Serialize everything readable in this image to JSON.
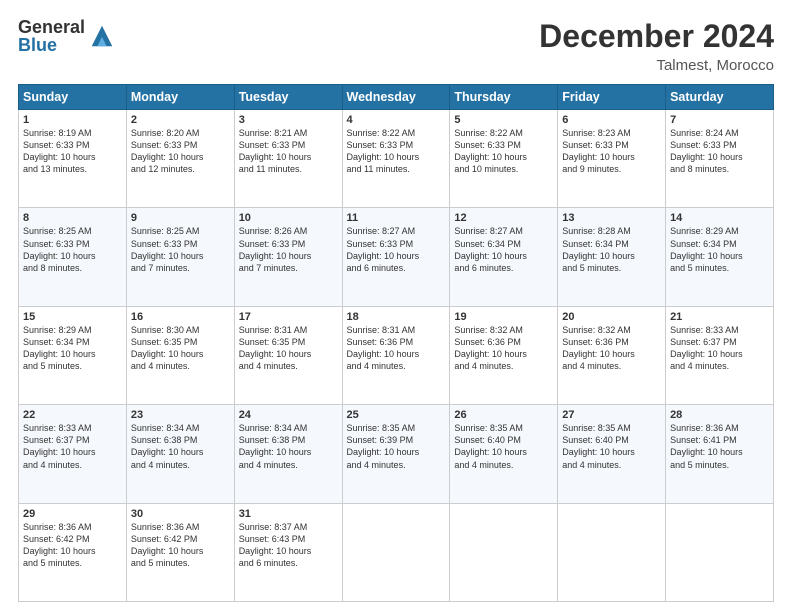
{
  "header": {
    "logo_general": "General",
    "logo_blue": "Blue",
    "title": "December 2024",
    "location": "Talmest, Morocco"
  },
  "days_of_week": [
    "Sunday",
    "Monday",
    "Tuesday",
    "Wednesday",
    "Thursday",
    "Friday",
    "Saturday"
  ],
  "weeks": [
    [
      {
        "day": "1",
        "info": "Sunrise: 8:19 AM\nSunset: 6:33 PM\nDaylight: 10 hours\nand 13 minutes."
      },
      {
        "day": "2",
        "info": "Sunrise: 8:20 AM\nSunset: 6:33 PM\nDaylight: 10 hours\nand 12 minutes."
      },
      {
        "day": "3",
        "info": "Sunrise: 8:21 AM\nSunset: 6:33 PM\nDaylight: 10 hours\nand 11 minutes."
      },
      {
        "day": "4",
        "info": "Sunrise: 8:22 AM\nSunset: 6:33 PM\nDaylight: 10 hours\nand 11 minutes."
      },
      {
        "day": "5",
        "info": "Sunrise: 8:22 AM\nSunset: 6:33 PM\nDaylight: 10 hours\nand 10 minutes."
      },
      {
        "day": "6",
        "info": "Sunrise: 8:23 AM\nSunset: 6:33 PM\nDaylight: 10 hours\nand 9 minutes."
      },
      {
        "day": "7",
        "info": "Sunrise: 8:24 AM\nSunset: 6:33 PM\nDaylight: 10 hours\nand 8 minutes."
      }
    ],
    [
      {
        "day": "8",
        "info": "Sunrise: 8:25 AM\nSunset: 6:33 PM\nDaylight: 10 hours\nand 8 minutes."
      },
      {
        "day": "9",
        "info": "Sunrise: 8:25 AM\nSunset: 6:33 PM\nDaylight: 10 hours\nand 7 minutes."
      },
      {
        "day": "10",
        "info": "Sunrise: 8:26 AM\nSunset: 6:33 PM\nDaylight: 10 hours\nand 7 minutes."
      },
      {
        "day": "11",
        "info": "Sunrise: 8:27 AM\nSunset: 6:33 PM\nDaylight: 10 hours\nand 6 minutes."
      },
      {
        "day": "12",
        "info": "Sunrise: 8:27 AM\nSunset: 6:34 PM\nDaylight: 10 hours\nand 6 minutes."
      },
      {
        "day": "13",
        "info": "Sunrise: 8:28 AM\nSunset: 6:34 PM\nDaylight: 10 hours\nand 5 minutes."
      },
      {
        "day": "14",
        "info": "Sunrise: 8:29 AM\nSunset: 6:34 PM\nDaylight: 10 hours\nand 5 minutes."
      }
    ],
    [
      {
        "day": "15",
        "info": "Sunrise: 8:29 AM\nSunset: 6:34 PM\nDaylight: 10 hours\nand 5 minutes."
      },
      {
        "day": "16",
        "info": "Sunrise: 8:30 AM\nSunset: 6:35 PM\nDaylight: 10 hours\nand 4 minutes."
      },
      {
        "day": "17",
        "info": "Sunrise: 8:31 AM\nSunset: 6:35 PM\nDaylight: 10 hours\nand 4 minutes."
      },
      {
        "day": "18",
        "info": "Sunrise: 8:31 AM\nSunset: 6:36 PM\nDaylight: 10 hours\nand 4 minutes."
      },
      {
        "day": "19",
        "info": "Sunrise: 8:32 AM\nSunset: 6:36 PM\nDaylight: 10 hours\nand 4 minutes."
      },
      {
        "day": "20",
        "info": "Sunrise: 8:32 AM\nSunset: 6:36 PM\nDaylight: 10 hours\nand 4 minutes."
      },
      {
        "day": "21",
        "info": "Sunrise: 8:33 AM\nSunset: 6:37 PM\nDaylight: 10 hours\nand 4 minutes."
      }
    ],
    [
      {
        "day": "22",
        "info": "Sunrise: 8:33 AM\nSunset: 6:37 PM\nDaylight: 10 hours\nand 4 minutes."
      },
      {
        "day": "23",
        "info": "Sunrise: 8:34 AM\nSunset: 6:38 PM\nDaylight: 10 hours\nand 4 minutes."
      },
      {
        "day": "24",
        "info": "Sunrise: 8:34 AM\nSunset: 6:38 PM\nDaylight: 10 hours\nand 4 minutes."
      },
      {
        "day": "25",
        "info": "Sunrise: 8:35 AM\nSunset: 6:39 PM\nDaylight: 10 hours\nand 4 minutes."
      },
      {
        "day": "26",
        "info": "Sunrise: 8:35 AM\nSunset: 6:40 PM\nDaylight: 10 hours\nand 4 minutes."
      },
      {
        "day": "27",
        "info": "Sunrise: 8:35 AM\nSunset: 6:40 PM\nDaylight: 10 hours\nand 4 minutes."
      },
      {
        "day": "28",
        "info": "Sunrise: 8:36 AM\nSunset: 6:41 PM\nDaylight: 10 hours\nand 5 minutes."
      }
    ],
    [
      {
        "day": "29",
        "info": "Sunrise: 8:36 AM\nSunset: 6:42 PM\nDaylight: 10 hours\nand 5 minutes."
      },
      {
        "day": "30",
        "info": "Sunrise: 8:36 AM\nSunset: 6:42 PM\nDaylight: 10 hours\nand 5 minutes."
      },
      {
        "day": "31",
        "info": "Sunrise: 8:37 AM\nSunset: 6:43 PM\nDaylight: 10 hours\nand 6 minutes."
      },
      null,
      null,
      null,
      null
    ]
  ]
}
